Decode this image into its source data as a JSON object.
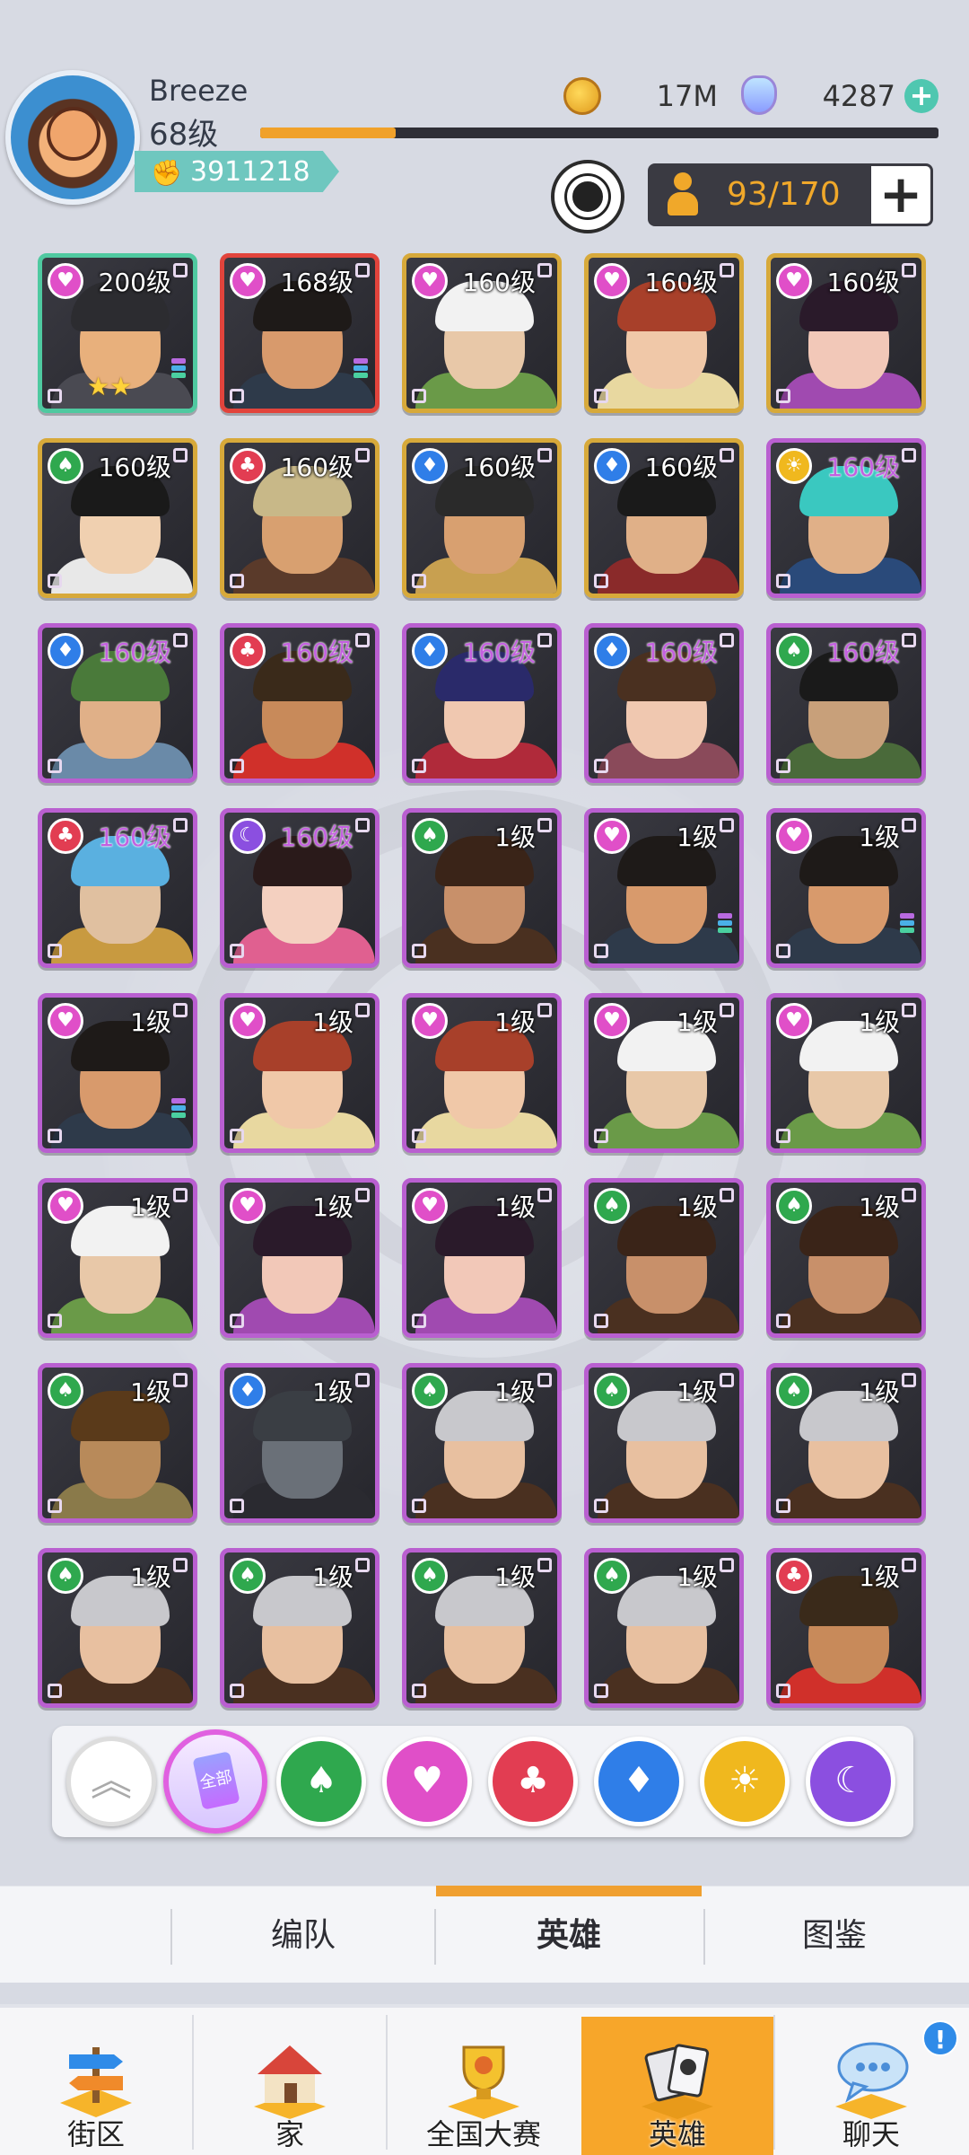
{
  "player": {
    "name": "Breeze",
    "level": "68级",
    "power": "3911218",
    "xp_progress": 0.2
  },
  "currency": {
    "coins": "17M",
    "gems": "4287",
    "add_symbol": "+"
  },
  "roster": {
    "count": "93/170",
    "add_symbol": "+"
  },
  "heroes": [
    {
      "level": "200级",
      "faction": "heart",
      "frame": "teal",
      "portrait": "armored-warrior",
      "stars": "★★",
      "bars": true
    },
    {
      "level": "168级",
      "faction": "heart",
      "frame": "red",
      "portrait": "tattooed-fighter",
      "bars": true
    },
    {
      "level": "160级",
      "faction": "heart",
      "frame": "gold",
      "portrait": "white-beard-sage"
    },
    {
      "level": "160级",
      "faction": "heart",
      "frame": "gold",
      "portrait": "red-hair-warrior"
    },
    {
      "level": "160级",
      "faction": "heart",
      "frame": "gold",
      "portrait": "purple-headband-lady"
    },
    {
      "level": "160级",
      "faction": "spade",
      "frame": "gold",
      "portrait": "white-robe-scholar"
    },
    {
      "level": "160级",
      "faction": "club",
      "frame": "gold",
      "portrait": "straw-hat-warrior"
    },
    {
      "level": "160级",
      "faction": "diamond",
      "frame": "gold",
      "portrait": "eye-patch-general"
    },
    {
      "level": "160级",
      "faction": "diamond",
      "frame": "gold",
      "portrait": "black-hat-officer"
    },
    {
      "level": "160级",
      "faction": "sun",
      "frame": "purple",
      "portrait": "cyan-hair-brawler"
    },
    {
      "level": "160级",
      "faction": "diamond",
      "frame": "purple",
      "portrait": "green-hair-tattooed"
    },
    {
      "level": "160级",
      "faction": "club",
      "frame": "purple",
      "portrait": "red-scarf-monkey"
    },
    {
      "level": "160级",
      "faction": "diamond",
      "frame": "purple",
      "portrait": "ninja-girl"
    },
    {
      "level": "160级",
      "faction": "diamond",
      "frame": "purple",
      "portrait": "brown-hair-girl"
    },
    {
      "level": "160级",
      "faction": "spade",
      "frame": "purple",
      "portrait": "green-swordsman"
    },
    {
      "level": "160级",
      "faction": "club",
      "frame": "purple",
      "portrait": "blue-hair-sage"
    },
    {
      "level": "160级",
      "faction": "moon",
      "frame": "purple",
      "portrait": "fan-lady"
    },
    {
      "level": "1级",
      "faction": "spade",
      "frame": "purple",
      "portrait": "bearded-brute"
    },
    {
      "level": "1级",
      "faction": "heart",
      "frame": "purple",
      "portrait": "tattooed-fighter",
      "bars": true
    },
    {
      "level": "1级",
      "faction": "heart",
      "frame": "purple",
      "portrait": "tattooed-fighter",
      "bars": true
    },
    {
      "level": "1级",
      "faction": "heart",
      "frame": "purple",
      "portrait": "tattooed-fighter",
      "bars": true
    },
    {
      "level": "1级",
      "faction": "heart",
      "frame": "purple",
      "portrait": "red-hair-warrior"
    },
    {
      "level": "1级",
      "faction": "heart",
      "frame": "purple",
      "portrait": "red-hair-warrior"
    },
    {
      "level": "1级",
      "faction": "heart",
      "frame": "purple",
      "portrait": "white-beard-sage"
    },
    {
      "level": "1级",
      "faction": "heart",
      "frame": "purple",
      "portrait": "white-beard-sage"
    },
    {
      "level": "1级",
      "faction": "heart",
      "frame": "purple",
      "portrait": "white-beard-sage"
    },
    {
      "level": "1级",
      "faction": "heart",
      "frame": "purple",
      "portrait": "purple-headband-lady"
    },
    {
      "level": "1级",
      "faction": "heart",
      "frame": "purple",
      "portrait": "purple-headband-lady"
    },
    {
      "level": "1级",
      "faction": "spade",
      "frame": "purple",
      "portrait": "bearded-brute"
    },
    {
      "level": "1级",
      "faction": "spade",
      "frame": "purple",
      "portrait": "bearded-brute"
    },
    {
      "level": "1级",
      "faction": "spade",
      "frame": "purple",
      "portrait": "goblin-shaman"
    },
    {
      "level": "1级",
      "faction": "diamond",
      "frame": "purple",
      "portrait": "wolf-warrior"
    },
    {
      "level": "1级",
      "faction": "spade",
      "frame": "purple",
      "portrait": "silver-hair-monk"
    },
    {
      "level": "1级",
      "faction": "spade",
      "frame": "purple",
      "portrait": "silver-hair-monk"
    },
    {
      "level": "1级",
      "faction": "spade",
      "frame": "purple",
      "portrait": "silver-hair-monk"
    },
    {
      "level": "1级",
      "faction": "spade",
      "frame": "purple",
      "portrait": "silver-hair-monk"
    },
    {
      "level": "1级",
      "faction": "spade",
      "frame": "purple",
      "portrait": "silver-hair-monk"
    },
    {
      "level": "1级",
      "faction": "spade",
      "frame": "purple",
      "portrait": "silver-hair-monk"
    },
    {
      "level": "1级",
      "faction": "spade",
      "frame": "purple",
      "portrait": "silver-hair-monk"
    },
    {
      "level": "1级",
      "faction": "club",
      "frame": "purple",
      "portrait": "red-scarf-monkey"
    }
  ],
  "filters": {
    "collapse_symbol": "︽",
    "all_label": "全部",
    "items": [
      {
        "name": "spade",
        "symbol": "♠",
        "color": "#2fa84e"
      },
      {
        "name": "heart",
        "symbol": "♥",
        "color": "#e04fc8"
      },
      {
        "name": "club",
        "symbol": "♣",
        "color": "#e23d52"
      },
      {
        "name": "diamond",
        "symbol": "♦",
        "color": "#2f7ee8"
      },
      {
        "name": "sun",
        "symbol": "☀",
        "color": "#f0b81e"
      },
      {
        "name": "moon",
        "symbol": "☾",
        "color": "#8b4fe0"
      }
    ]
  },
  "faction_colors": {
    "spade": "#2fa84e",
    "heart": "#e04fc8",
    "club": "#e23d52",
    "diamond": "#2f7ee8",
    "sun": "#f0b81e",
    "moon": "#8b4fe0"
  },
  "faction_symbols": {
    "spade": "♠",
    "heart": "♥",
    "club": "♣",
    "diamond": "♦",
    "sun": "☀",
    "moon": "☾"
  },
  "tabs": {
    "formation": "编队",
    "heroes": "英雄",
    "codex": "图鉴"
  },
  "bottom_nav": {
    "street": "街区",
    "home": "家",
    "tournament": "全国大赛",
    "heroes": "英雄",
    "chat": "聊天",
    "chat_badge": "!"
  }
}
